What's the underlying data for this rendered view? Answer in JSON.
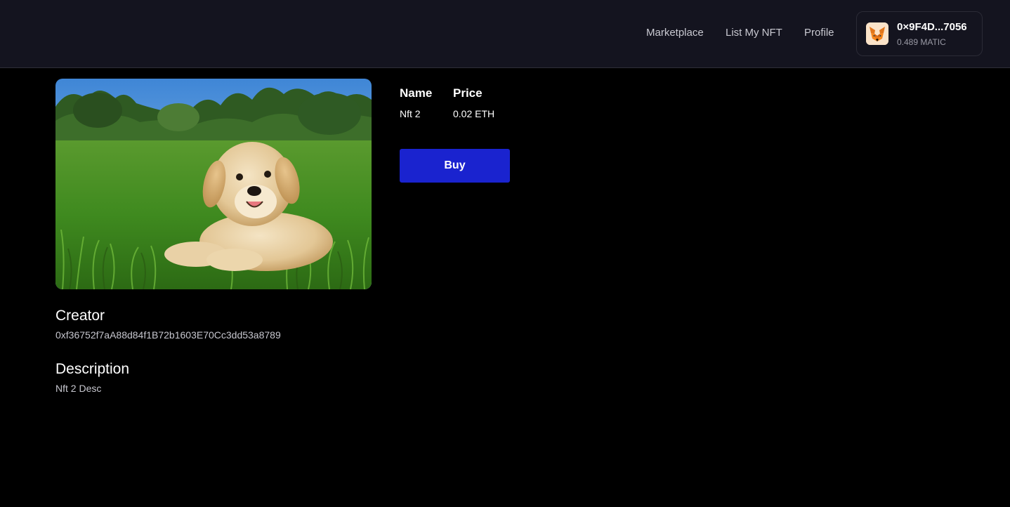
{
  "nav": {
    "marketplace": "Marketplace",
    "list_my_nft": "List My NFT",
    "profile": "Profile"
  },
  "wallet": {
    "icon": "metamask-fox-icon",
    "address": "0×9F4D...7056",
    "balance": "0.489 MATIC"
  },
  "nft": {
    "image": "golden-retriever-puppy-in-grass",
    "name_label": "Name",
    "name_value": "Nft 2",
    "price_label": "Price",
    "price_value": "0.02 ETH",
    "buy_label": "Buy",
    "creator_heading": "Creator",
    "creator_address": "0xf36752f7aA88d84f1B72b1603E70Cc3dd53a8789",
    "description_heading": "Description",
    "description_text": "Nft 2 Desc"
  },
  "colors": {
    "background": "#000000",
    "header": "#14141f",
    "buy_button": "#1a23cf"
  }
}
